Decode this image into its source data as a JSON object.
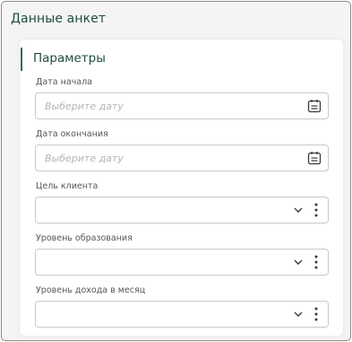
{
  "window": {
    "title": "Данные анкет"
  },
  "section": {
    "title": "Параметры"
  },
  "fields": [
    {
      "label": "Дата начала",
      "placeholder": "Выберите дату",
      "type": "date",
      "icon": "calendar-icon"
    },
    {
      "label": "Дата окончания",
      "placeholder": "Выберите дату",
      "type": "date",
      "icon": "calendar-icon"
    },
    {
      "label": "Цель клиента",
      "value": "",
      "type": "select",
      "icon": "chevron-down-icon"
    },
    {
      "label": "Уровень образования",
      "value": "",
      "type": "select",
      "icon": "chevron-down-icon"
    },
    {
      "label": "Уровень дохода в месяц",
      "value": "",
      "type": "select",
      "icon": "chevron-down-icon"
    }
  ],
  "colors": {
    "accent": "#2e6b4f",
    "title": "#1f4d3a",
    "border": "#c8c8c8",
    "icon": "#3a3a3a"
  }
}
